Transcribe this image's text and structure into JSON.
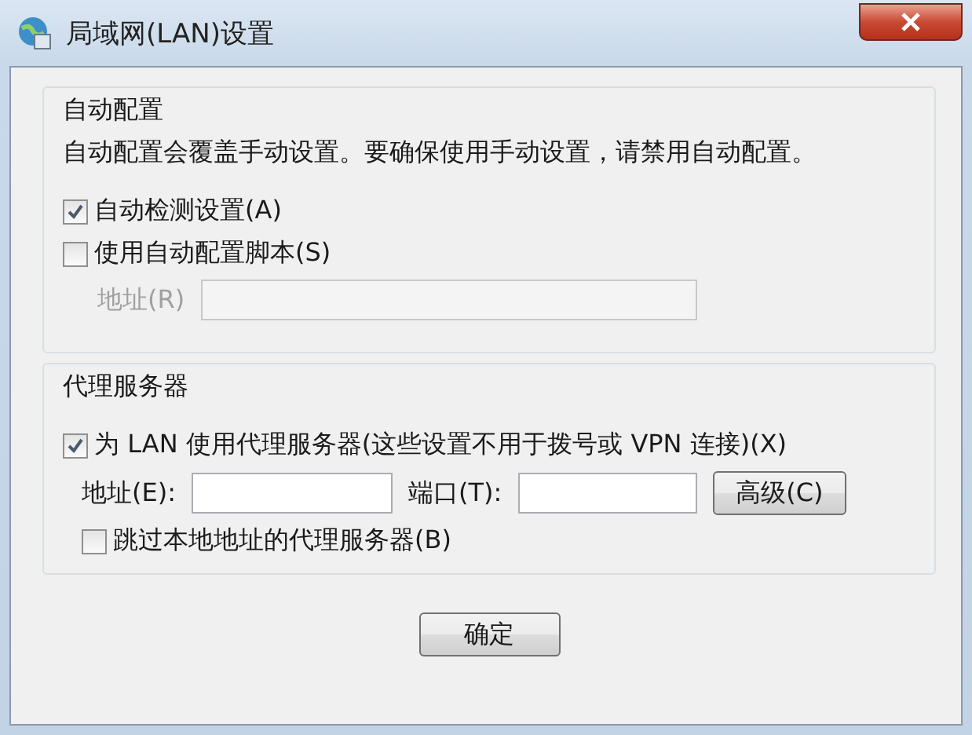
{
  "window": {
    "title": "局域网(LAN)设置"
  },
  "auto_config": {
    "title": "自动配置",
    "description": "自动配置会覆盖手动设置。要确保使用手动设置，请禁用自动配置。",
    "options": [
      {
        "label": "自动检测设置(A)",
        "checked": true
      },
      {
        "label": "使用自动配置脚本(S)",
        "checked": false
      }
    ],
    "address": {
      "label": "地址(R)",
      "disabled": true
    }
  },
  "proxy": {
    "title": "代理服务器",
    "use_proxy": {
      "label": "为 LAN 使用代理服务器(这些设置不用于拨号或 VPN 连接)(X)",
      "checked": true
    },
    "address": {
      "label": "地址(E):"
    },
    "port": {
      "label": "端口(T):"
    },
    "advanced_button": "高级(C)",
    "bypass": {
      "label": "跳过本地地址的代理服务器(B)",
      "checked": false
    }
  },
  "buttons": [
    "确定"
  ]
}
